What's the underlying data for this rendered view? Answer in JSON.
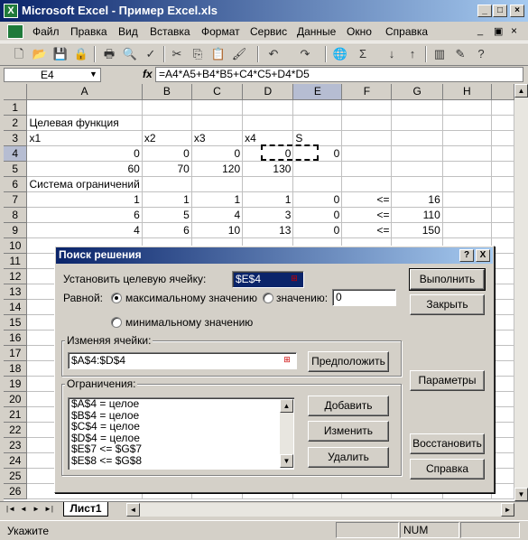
{
  "window": {
    "title": "Microsoft Excel - Пример Excel.xls",
    "app_icon": "X"
  },
  "menu": [
    "Файл",
    "Правка",
    "Вид",
    "Вставка",
    "Формат",
    "Сервис",
    "Данные",
    "Окно",
    "Справка"
  ],
  "toolbar": {
    "font_size_value": ""
  },
  "formula_bar": {
    "name_box": "E4",
    "fx_label": "fx",
    "formula": "=A4*A5+B4*B5+C4*C5+D4*D5"
  },
  "sheet": {
    "columns": [
      "A",
      "B",
      "C",
      "D",
      "E",
      "F",
      "G",
      "H"
    ],
    "rows": [
      {
        "n": "1",
        "cells": [
          "",
          "",
          "",
          "",
          "",
          "",
          "",
          ""
        ]
      },
      {
        "n": "2",
        "cells": [
          "Целевая функция",
          "",
          "",
          "",
          "",
          "",
          "",
          ""
        ]
      },
      {
        "n": "3",
        "cells": [
          "x1",
          "x2",
          "x3",
          "x4",
          "S",
          "",
          "",
          ""
        ]
      },
      {
        "n": "4",
        "cells": [
          "0",
          "0",
          "0",
          "0",
          "0",
          "",
          "",
          ""
        ]
      },
      {
        "n": "5",
        "cells": [
          "60",
          "70",
          "120",
          "130",
          "",
          "",
          "",
          ""
        ]
      },
      {
        "n": "6",
        "cells": [
          "Система ограничений",
          "",
          "",
          "",
          "",
          "",
          "",
          ""
        ]
      },
      {
        "n": "7",
        "cells": [
          "1",
          "1",
          "1",
          "1",
          "0",
          "<=",
          "16",
          ""
        ]
      },
      {
        "n": "8",
        "cells": [
          "6",
          "5",
          "4",
          "3",
          "0",
          "<=",
          "110",
          ""
        ]
      },
      {
        "n": "9",
        "cells": [
          "4",
          "6",
          "10",
          "13",
          "0",
          "<=",
          "150",
          ""
        ]
      },
      {
        "n": "10",
        "cells": [
          "",
          "",
          "",
          "",
          "",
          "",
          "",
          ""
        ]
      },
      {
        "n": "11",
        "cells": [
          "",
          "",
          "",
          "",
          "",
          "",
          "",
          ""
        ]
      },
      {
        "n": "12",
        "cells": [
          "",
          "",
          "",
          "",
          "",
          "",
          "",
          ""
        ]
      },
      {
        "n": "13",
        "cells": [
          "",
          "",
          "",
          "",
          "",
          "",
          "",
          ""
        ]
      },
      {
        "n": "14",
        "cells": [
          "",
          "",
          "",
          "",
          "",
          "",
          "",
          ""
        ]
      },
      {
        "n": "15",
        "cells": [
          "",
          "",
          "",
          "",
          "",
          "",
          "",
          ""
        ]
      },
      {
        "n": "16",
        "cells": [
          "",
          "",
          "",
          "",
          "",
          "",
          "",
          ""
        ]
      },
      {
        "n": "17",
        "cells": [
          "",
          "",
          "",
          "",
          "",
          "",
          "",
          ""
        ]
      },
      {
        "n": "18",
        "cells": [
          "",
          "",
          "",
          "",
          "",
          "",
          "",
          ""
        ]
      },
      {
        "n": "19",
        "cells": [
          "",
          "",
          "",
          "",
          "",
          "",
          "",
          ""
        ]
      },
      {
        "n": "20",
        "cells": [
          "",
          "",
          "",
          "",
          "",
          "",
          "",
          ""
        ]
      },
      {
        "n": "21",
        "cells": [
          "",
          "",
          "",
          "",
          "",
          "",
          "",
          ""
        ]
      },
      {
        "n": "22",
        "cells": [
          "",
          "",
          "",
          "",
          "",
          "",
          "",
          ""
        ]
      },
      {
        "n": "23",
        "cells": [
          "",
          "",
          "",
          "",
          "",
          "",
          "",
          ""
        ]
      },
      {
        "n": "24",
        "cells": [
          "",
          "",
          "",
          "",
          "",
          "",
          "",
          ""
        ]
      },
      {
        "n": "25",
        "cells": [
          "",
          "",
          "",
          "",
          "",
          "",
          "",
          ""
        ]
      },
      {
        "n": "26",
        "cells": [
          "",
          "",
          "",
          "",
          "",
          "",
          "",
          ""
        ]
      }
    ],
    "tab": "Лист1"
  },
  "status": {
    "text": "Укажите",
    "num": "NUM"
  },
  "dialog": {
    "title": "Поиск решения",
    "help_btn": "?",
    "close_btn": "X",
    "target_label": "Установить целевую ячейку:",
    "target_value": "$E$4",
    "equal_label": "Равной:",
    "radio_max": "максимальному значению",
    "radio_value": "значению:",
    "value_field": "0",
    "radio_min": "минимальному значению",
    "changing_label": "Изменяя ячейки:",
    "changing_value": "$A$4:$D$4",
    "guess_btn": "Предположить",
    "constraints_label": "Ограничения:",
    "constraints": [
      "$A$4 = целое",
      "$B$4 = целое",
      "$C$4 = целое",
      "$D$4 = целое",
      "$E$7 <= $G$7",
      "$E$8 <= $G$8"
    ],
    "add_btn": "Добавить",
    "change_btn": "Изменить",
    "delete_btn": "Удалить",
    "solve_btn": "Выполнить",
    "close_label": "Закрыть",
    "options_btn": "Параметры",
    "reset_btn": "Восстановить",
    "help_label": "Справка"
  }
}
